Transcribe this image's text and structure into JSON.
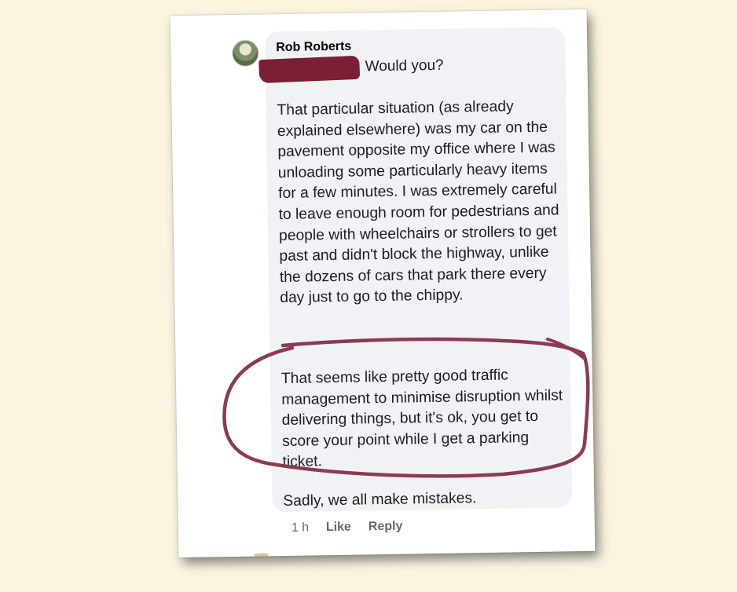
{
  "comment": {
    "author": "Rob Roberts",
    "mention_tail": "Would you?",
    "paragraphs": [
      "That particular situation (as already explained elsewhere) was my car on the pavement opposite my office where I was unloading some particularly heavy items for a few minutes. I was extremely careful to leave enough room for pedestrians and people with wheelchairs or strollers to get past and didn't block the highway, unlike the dozens of cars that park there every day just to go to the chippy.",
      "That seems like pretty good traffic management to minimise disruption whilst delivering things, but it's ok, you get to score your point while I get a parking ticket.",
      "Sadly, we all make mistakes."
    ],
    "time": "1 h",
    "like_label": "Like",
    "reply_label": "Reply"
  },
  "colors": {
    "background": "#fbf5e0",
    "bubble": "#f0f2f5",
    "redaction": "#7a1f34",
    "annotation_circle": "#8b3a55"
  },
  "icons": {
    "avatar": "profile-photo"
  }
}
